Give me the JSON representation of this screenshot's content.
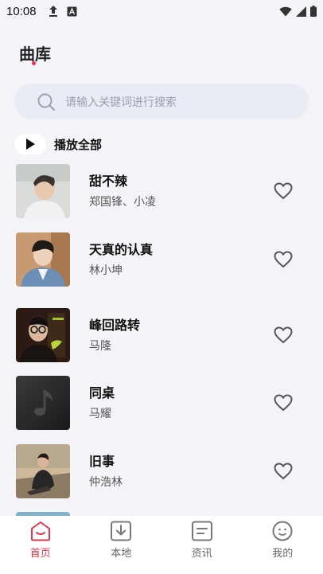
{
  "status_bar": {
    "time": "10:08"
  },
  "header": {
    "title": "曲库"
  },
  "search": {
    "placeholder": "请输入关键词进行搜索"
  },
  "play_all": {
    "label": "播放全部"
  },
  "songs": [
    {
      "title": "甜不辣",
      "artist": "郑国锋、小凌"
    },
    {
      "title": "天真的认真",
      "artist": "林小坤"
    },
    {
      "title": "峰回路转",
      "artist": "马隆"
    },
    {
      "title": "同桌",
      "artist": "马耀"
    },
    {
      "title": "旧事",
      "artist": "仲浩林"
    }
  ],
  "tabs": [
    {
      "label": "首页",
      "icon": "home-icon",
      "active": true
    },
    {
      "label": "本地",
      "icon": "download-icon",
      "active": false
    },
    {
      "label": "资讯",
      "icon": "news-icon",
      "active": false
    },
    {
      "label": "我的",
      "icon": "profile-icon",
      "active": false
    }
  ],
  "colors": {
    "accent": "#e5344a",
    "background": "#f4f4f8",
    "search_bg": "#e9ecf5"
  }
}
